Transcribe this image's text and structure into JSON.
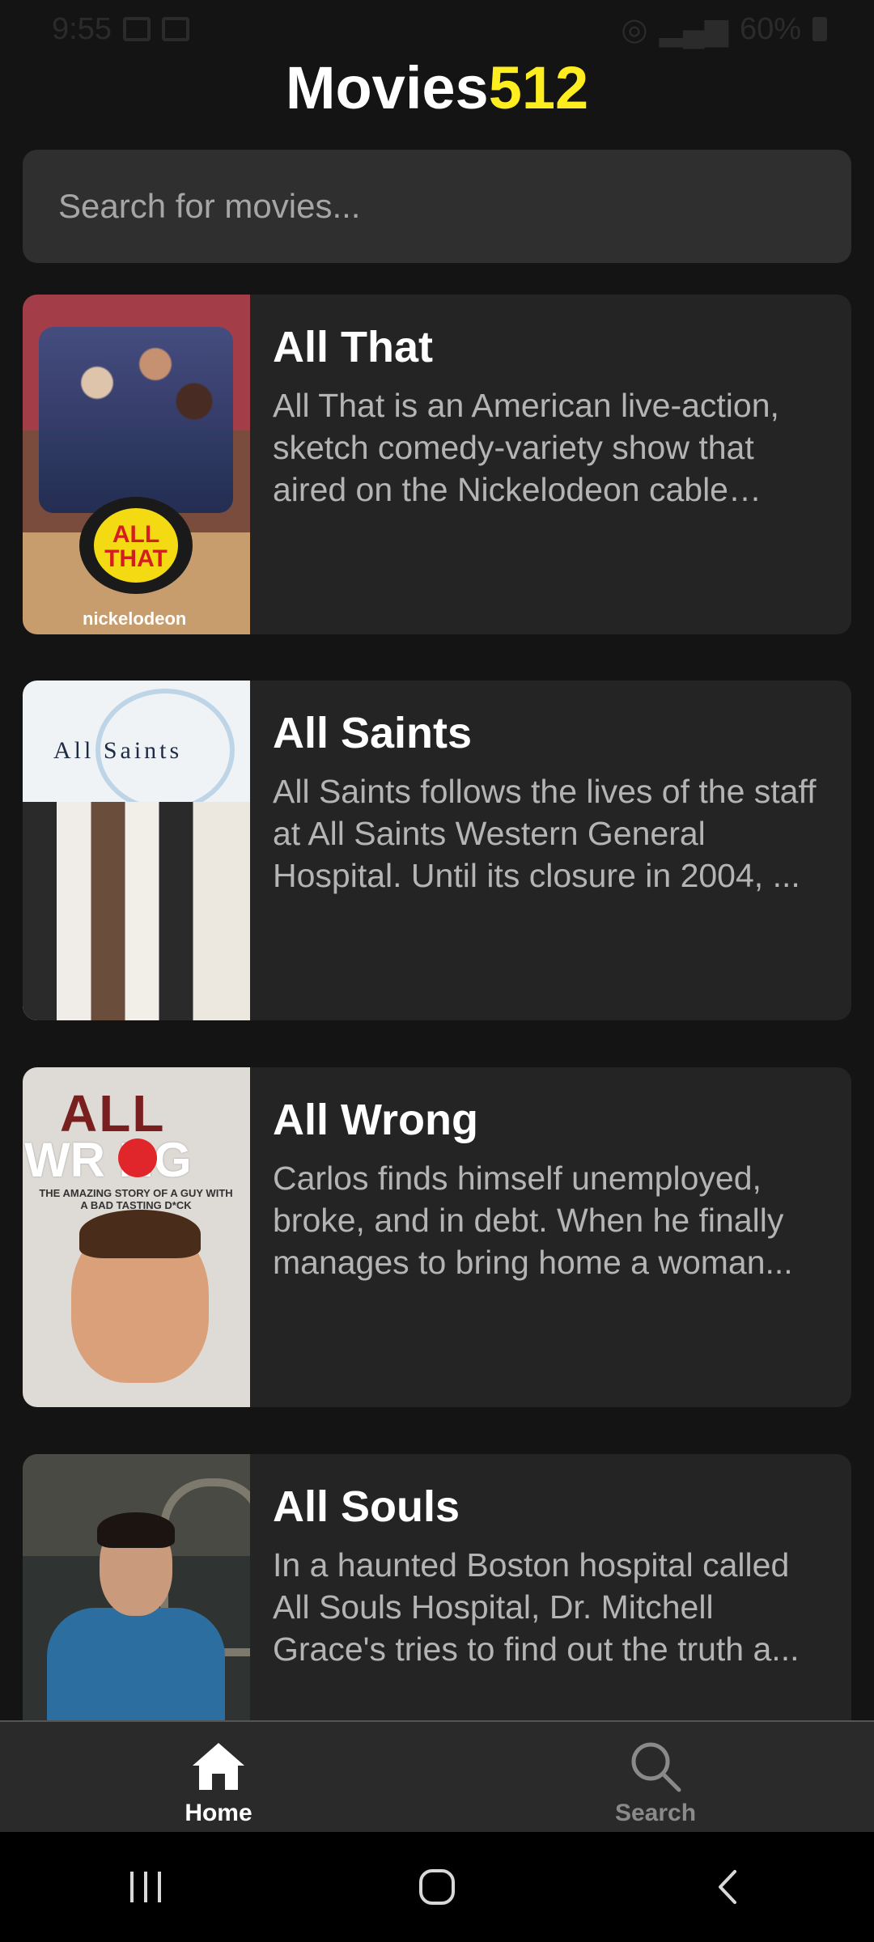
{
  "status_bar": {
    "time": "9:55",
    "battery": "60%"
  },
  "app": {
    "title_main": "Movies",
    "title_accent": "512",
    "accent_color": "#ffee1f"
  },
  "search": {
    "placeholder": "Search for movies...",
    "value": ""
  },
  "movies": [
    {
      "title": "All That",
      "description": "All That is an American live-action, sketch comedy-variety show that aired on the Nickelodeon cable television network...",
      "poster_text": "ALL THAT",
      "poster_brand": "nickelodeon"
    },
    {
      "title": "All Saints",
      "description": "All Saints follows the lives of the staff at All Saints Western General Hospital. Until its closure in 2004, ...",
      "poster_text": "All Saints"
    },
    {
      "title": "All Wrong",
      "description": "Carlos finds himself unemployed, broke, and in debt. When he finally manages to bring home a woman...",
      "poster_text_1": "ALL",
      "poster_text_2": "WR  NG",
      "poster_tagline": "THE AMAZING STORY OF A GUY WITH A BAD TASTING D*CK"
    },
    {
      "title": "All Souls",
      "description": "In a haunted Boston hospital called All Souls Hospital, Dr. Mitchell Grace's tries to find out the truth a..."
    }
  ],
  "bottom_nav": {
    "home_label": "Home",
    "search_label": "Search",
    "active": "home"
  },
  "system_nav": {
    "recents_icon": "recents-icon",
    "home_icon": "home-circle-icon",
    "back_icon": "back-chevron-icon"
  }
}
